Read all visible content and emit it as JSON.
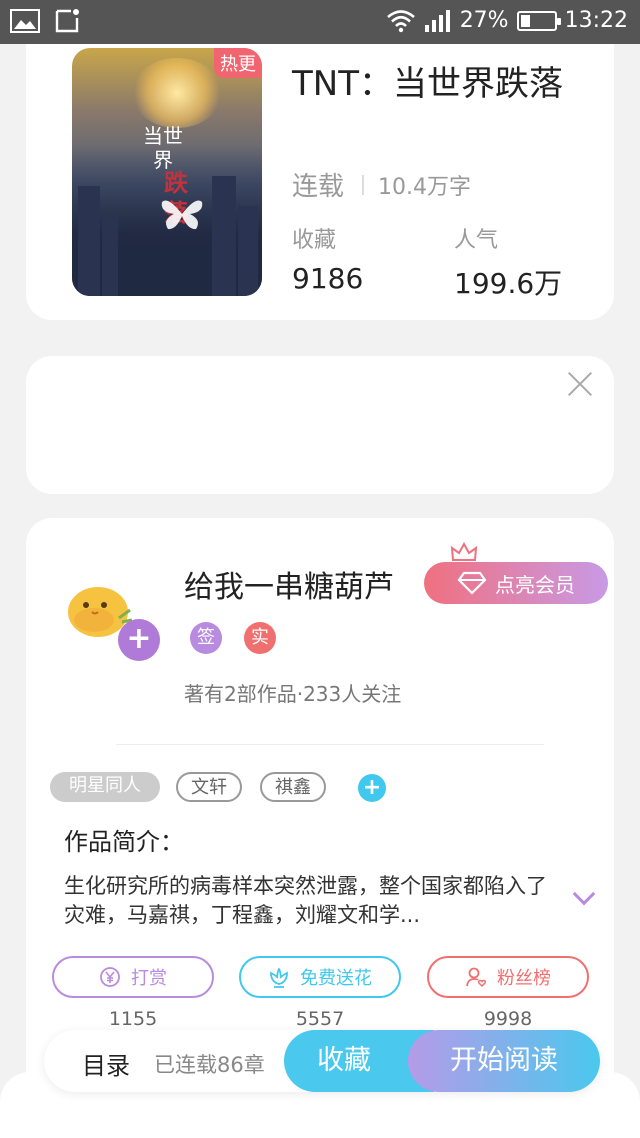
{
  "status_bar": {
    "battery": "27%",
    "battery_level": 0.27,
    "time": "13:22"
  },
  "book": {
    "hot_badge": "热更",
    "cover_title": "当世界",
    "cover_title_red": "跌落",
    "title": "TNT：当世界跌落",
    "status": "连载",
    "word_count": "10.4万字",
    "favorites_label": "收藏",
    "favorites_value": "9186",
    "popularity_label": "人气",
    "popularity_value": "199.6万"
  },
  "author": {
    "name": "给我一串糖葫芦",
    "follow_plus": "+",
    "vip_label": "点亮会员",
    "badge_signed": "签",
    "badge_verified": "实",
    "stats": "著有2部作品·233人关注"
  },
  "tags": [
    "明星同人",
    "文轩",
    "祺鑫"
  ],
  "tag_add": "+",
  "intro": {
    "heading": "作品简介：",
    "text": "生化研究所的病毒样本突然泄露，整个国家都陷入了灾难，马嘉祺，丁程鑫，刘耀文和学..."
  },
  "actions": [
    {
      "label": "打赏",
      "count": "1155",
      "color": "#b98be0"
    },
    {
      "label": "免费送花",
      "count": "5557",
      "color": "#40c8ee"
    },
    {
      "label": "粉丝榜",
      "count": "9998",
      "color": "#f07070"
    }
  ],
  "bottom_bar": {
    "toc": "目录",
    "chapters": "已连载86章",
    "favorite": "收藏",
    "start_reading": "开始阅读"
  }
}
